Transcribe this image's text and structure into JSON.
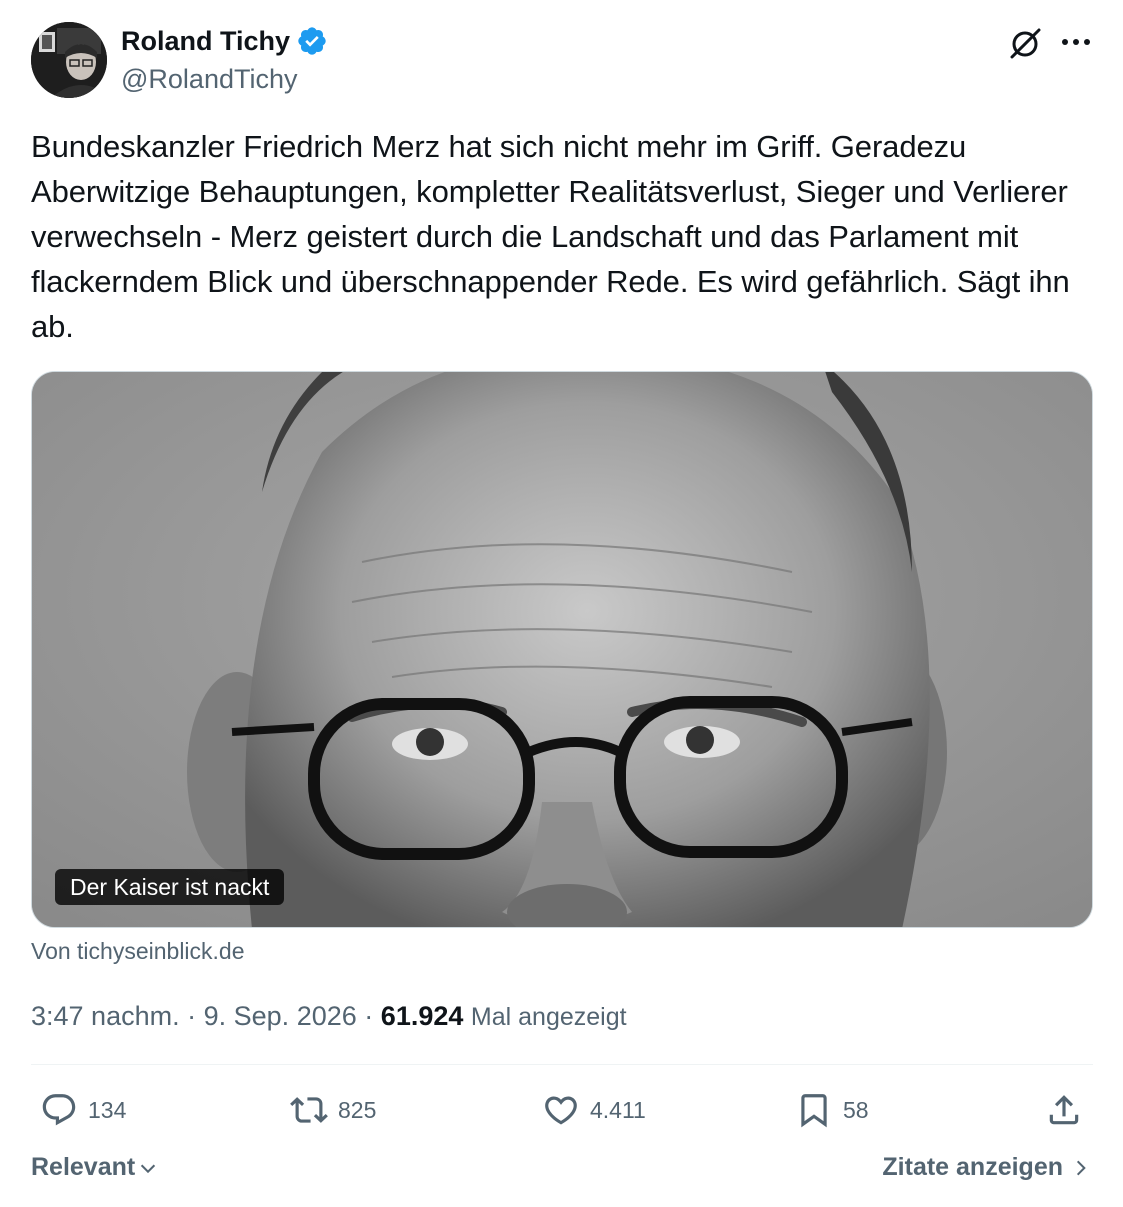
{
  "author": {
    "name": "Roland Tichy",
    "handle": "@RolandTichy",
    "verified": true
  },
  "icons": {
    "verified": "verified-badge-icon",
    "grok": "grok-icon",
    "more": "more-icon",
    "reply": "reply-icon",
    "repost": "repost-icon",
    "like": "like-icon",
    "bookmark": "bookmark-icon",
    "share": "share-icon"
  },
  "tweet": {
    "text": "Bundeskanzler Friedrich Merz hat sich nicht mehr im Griff. Geradezu Aberwitzige Behauptungen, kompletter Realitätsverlust, Sieger und Verlierer verwechseln - Merz geistert durch die Landschaft und das Parlament mit flackerndem Blick und überschnappender Rede. Es wird gefährlich. Sägt ihn ab."
  },
  "media": {
    "card_title": "Der Kaiser ist nackt",
    "source": "Von tichyseinblick.de"
  },
  "meta": {
    "time": "3:47 nachm.",
    "separator": "·",
    "date": "9. Sep. 2026",
    "views_count": "61.924",
    "views_label": "Mal angezeigt"
  },
  "actions": {
    "replies": "134",
    "reposts": "825",
    "likes": "4.411",
    "bookmarks": "58"
  },
  "footer": {
    "sort_label": "Relevant",
    "quotes_label": "Zitate anzeigen"
  },
  "colors": {
    "text_primary": "#0f1419",
    "text_secondary": "#536471",
    "verified_blue": "#1d9bf0",
    "divider": "#eff3f4"
  }
}
